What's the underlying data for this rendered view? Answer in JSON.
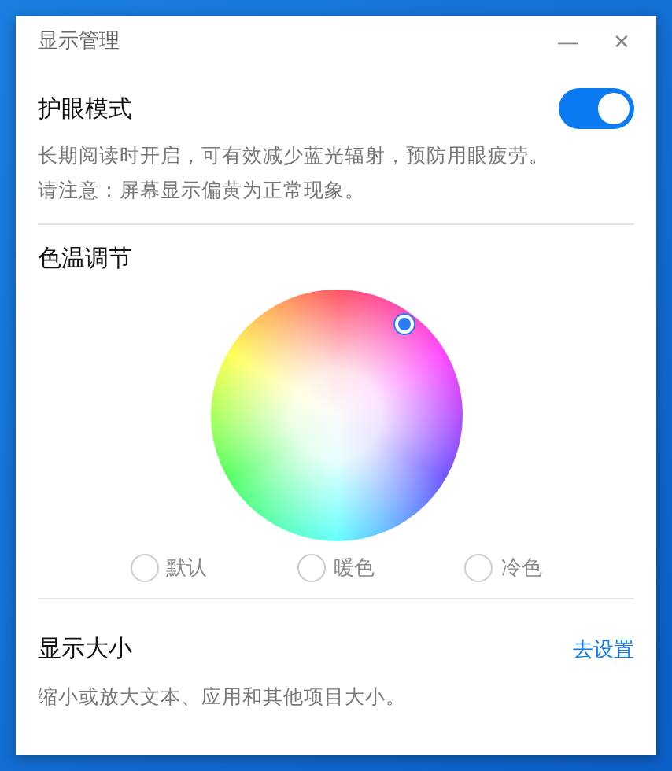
{
  "window": {
    "title": "显示管理",
    "minimize": "—",
    "close": "✕"
  },
  "eye_care": {
    "title": "护眼模式",
    "on": true,
    "description": [
      "长期阅读时开启，可有效减少蓝光辐射，预防用眼疲劳。",
      "请注意：屏幕显示偏黄为正常现象。"
    ]
  },
  "color_temperature": {
    "title": "色温调节",
    "presets": [
      {
        "label": "默认",
        "selected": false
      },
      {
        "label": "暖色",
        "selected": false
      },
      {
        "label": "冷色",
        "selected": false
      }
    ]
  },
  "display_size": {
    "title": "显示大小",
    "link": "去设置",
    "description": "缩小或放大文本、应用和其他项目大小。"
  }
}
